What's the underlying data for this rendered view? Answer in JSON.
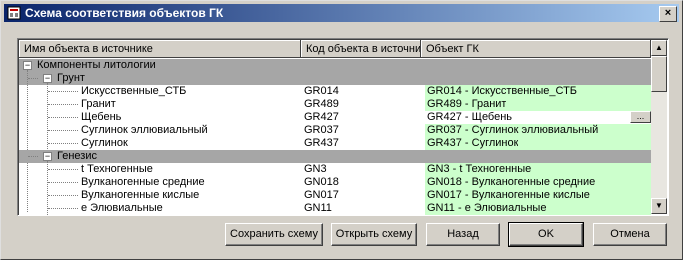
{
  "window": {
    "title": "Схема соответствия объектов ГК",
    "close_glyph": "×"
  },
  "grid": {
    "columns": [
      "Имя объекта в источнике",
      "Код объекта в источни",
      "Объект ГК"
    ],
    "rows": [
      {
        "name": "Компоненты литологии",
        "code": "",
        "target": "",
        "kind": "group",
        "level": 0
      },
      {
        "name": "Грунт",
        "code": "",
        "target": "",
        "kind": "group",
        "level": 1
      },
      {
        "name": "Искусственные_СТБ",
        "code": "GR014",
        "target": "GR014 - Искусственные_СТБ",
        "kind": "item"
      },
      {
        "name": "Гранит",
        "code": "GR489",
        "target": "GR489 - Гранит",
        "kind": "item"
      },
      {
        "name": "Щебень",
        "code": "GR427",
        "target": "GR427 - Щебень",
        "kind": "item",
        "selected": true
      },
      {
        "name": "Суглинок эллювиальный",
        "code": "GR037",
        "target": "GR037 - Суглинок эллювиальный",
        "kind": "item"
      },
      {
        "name": "Суглинок",
        "code": "GR437",
        "target": "GR437 - Суглинок",
        "kind": "item"
      },
      {
        "name": "Генезис",
        "code": "",
        "target": "",
        "kind": "group",
        "level": 1
      },
      {
        "name": "t Техногенные",
        "code": "GN3",
        "target": "GN3 - t Техногенные",
        "kind": "item"
      },
      {
        "name": "Вулканогенные средние",
        "code": "GN018",
        "target": "GN018 - Вулканогенные средние",
        "kind": "item"
      },
      {
        "name": "Вулканогенные кислые",
        "code": "GN017",
        "target": "GN017 - Вулканогенные кислые",
        "kind": "item"
      },
      {
        "name": "е Элювиальные",
        "code": "GN11",
        "target": "GN11 - е Элювиальные",
        "kind": "item"
      }
    ],
    "expander_glyph": "−",
    "ellipsis": "...",
    "scroll_up": "▲",
    "scroll_down": "▼"
  },
  "buttons": {
    "save": "Сохранить схему",
    "open": "Открыть схему",
    "back": "Назад",
    "ok": "OK",
    "cancel": "Отмена"
  },
  "colors": {
    "title_start": "#0a246a",
    "title_end": "#a6caf0",
    "mapped": "#ccffcc",
    "group_band": "#a6a6a6"
  },
  "icons": {
    "title": "window-app-icon"
  }
}
